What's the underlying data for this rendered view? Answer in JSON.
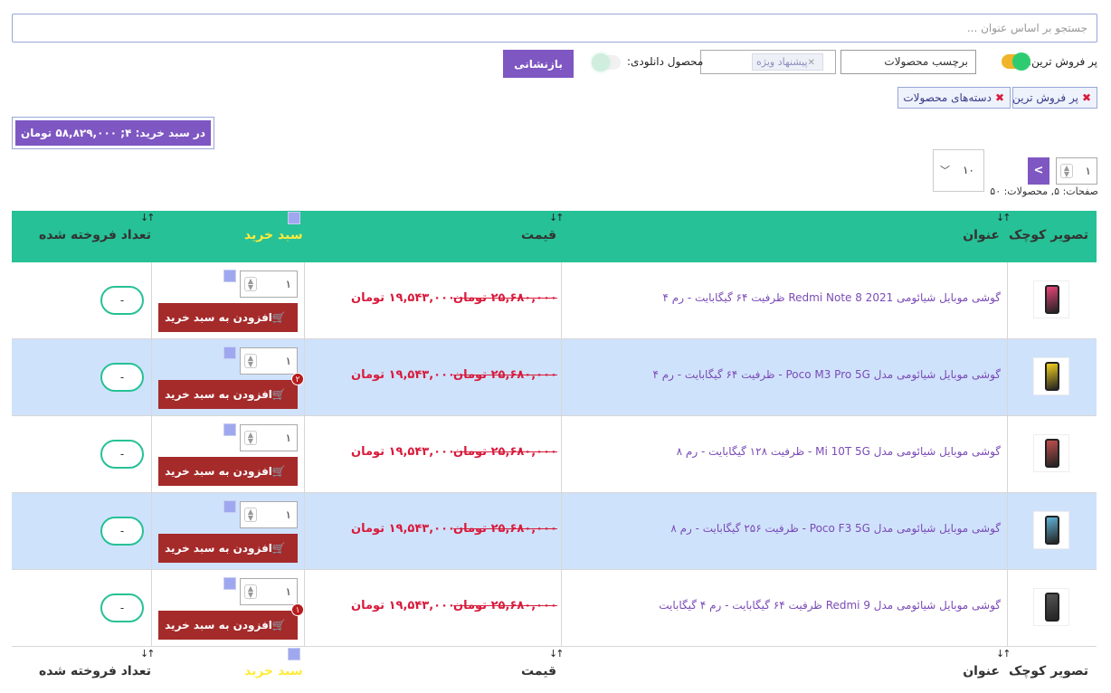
{
  "search": {
    "placeholder": "جستجو بر اساس عنوان ..."
  },
  "filters": {
    "bestseller_label": "پر فروش ترین:",
    "bestseller_on": true,
    "tag_select": "برچسب محصولات",
    "special_chip": "پیشنهاد ویژه",
    "download_label": "محصول دانلودی:",
    "download_on": false,
    "reset_label": "بازنشانی"
  },
  "active_filters": [
    {
      "label": "پر فروش ترین"
    },
    {
      "label": "دسته‌های محصولات"
    }
  ],
  "cart_summary": "در سبد خرید: ۴; ۵۸,۸۲۹,۰۰۰ تومان",
  "pager": {
    "current_page": "۱",
    "next": ">",
    "per_page": "۱۰",
    "info": "صفحات: ۵, محصولات: ۵۰"
  },
  "columns": {
    "thumbnail": "تصویر کوچک",
    "title": "عنوان",
    "price": "قیمت",
    "cart": "سبد خرید",
    "sold": "تعداد فروخته شده"
  },
  "colors": {
    "header": "#26c196",
    "accent": "#7e57c2",
    "add_button": "#a52a2a",
    "price": "#d81b3c",
    "alt_row": "#cfe2fb"
  },
  "add_to_cart_label": "افزودن به سبد خرید",
  "products": [
    {
      "title": "گوشی موبایل شیائومی Redmi Note 8 2021 ظرفیت ۶۴ گیگابایت - رم ۴",
      "old_price": "۲۵,۶۸۰,۰۰۰ تومان",
      "new_price": "۱۹,۵۴۳,۰۰۰ تومان",
      "qty": "۱",
      "sold": "-",
      "badge": "",
      "phone_color": "#e8457a"
    },
    {
      "title": "گوشی موبایل شیائومی مدل Poco M3 Pro 5G - ظرفیت ۶۴ گیگابایت - رم ۴",
      "old_price": "۲۵,۶۸۰,۰۰۰ تومان",
      "new_price": "۱۹,۵۴۳,۰۰۰ تومان",
      "qty": "۱",
      "sold": "-",
      "badge": "۲",
      "phone_color": "#f5d21d"
    },
    {
      "title": "گوشی موبایل شیائومی مدل Mi 10T 5G - ظرفیت ۱۲۸ گیگابایت - رم ۸",
      "old_price": "۲۵,۶۸۰,۰۰۰ تومان",
      "new_price": "۱۹,۵۴۳,۰۰۰ تومان",
      "qty": "۱",
      "sold": "-",
      "badge": "",
      "phone_color": "#c0504d"
    },
    {
      "title": "گوشی موبایل شیائومی مدل Poco F3 5G - ظرفیت ۲۵۶ گیگابایت - رم ۸",
      "old_price": "۲۵,۶۸۰,۰۰۰ تومان",
      "new_price": "۱۹,۵۴۳,۰۰۰ تومان",
      "qty": "۱",
      "sold": "-",
      "badge": "",
      "phone_color": "#5fb3d9"
    },
    {
      "title": "گوشی موبایل شیائومی مدل Redmi 9 ظرفیت ۶۴ گیگابایت - رم ۴ گیگابایت",
      "old_price": "۲۵,۶۸۰,۰۰۰ تومان",
      "new_price": "۱۹,۵۴۳,۰۰۰ تومان",
      "qty": "۱",
      "sold": "-",
      "badge": "۱",
      "phone_color": "#555555"
    }
  ]
}
